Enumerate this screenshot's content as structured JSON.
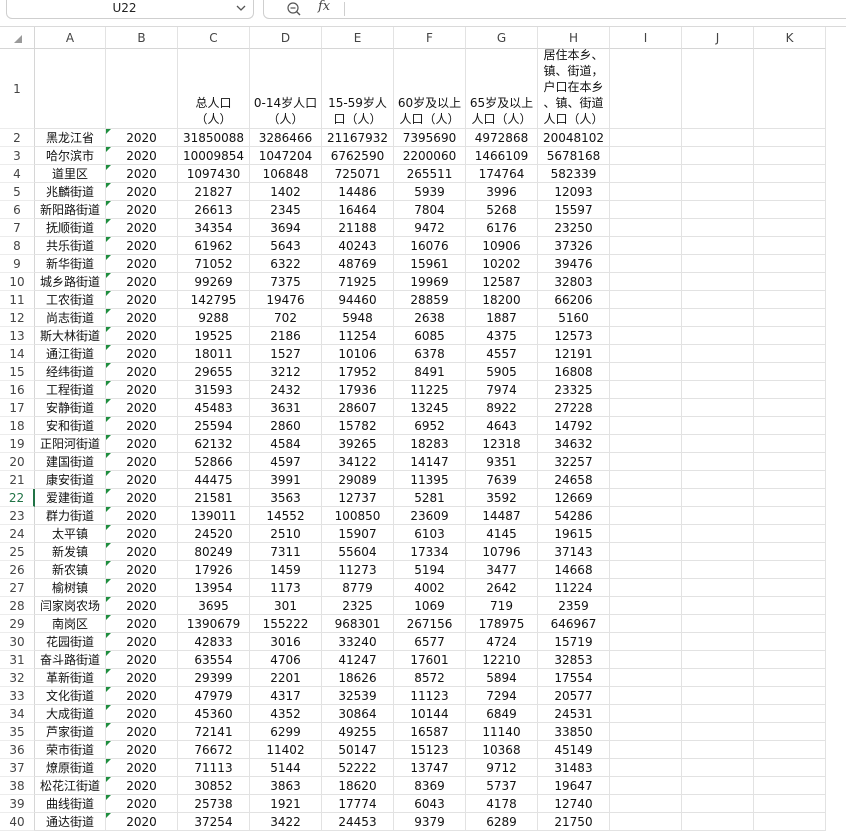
{
  "name_box": "U22",
  "formula_bar": {
    "fx_label": "fx",
    "value": ""
  },
  "columns": [
    "A",
    "B",
    "C",
    "D",
    "E",
    "F",
    "G",
    "H",
    "I",
    "J",
    "K"
  ],
  "active_row": "22",
  "header_row": {
    "row_num": "1",
    "cells": [
      "",
      "",
      "总人口\n（人）",
      "0-14岁人口\n（人）",
      "15-59岁人\n口（人）",
      "60岁及以上\n人口（人）",
      "65岁及以上\n人口（人）",
      "居住本乡、\n镇、街道，\n户口在本乡\n、镇、街道\n人口（人）"
    ]
  },
  "rows": [
    {
      "n": "2",
      "a": "黑龙江省",
      "b": "2020",
      "c": "31850088",
      "d": "3286466",
      "e": "21167932",
      "f": "7395690",
      "g": "4972868",
      "h": "20048102"
    },
    {
      "n": "3",
      "a": "哈尔滨市",
      "b": "2020",
      "c": "10009854",
      "d": "1047204",
      "e": "6762590",
      "f": "2200060",
      "g": "1466109",
      "h": "5678168"
    },
    {
      "n": "4",
      "a": "道里区",
      "b": "2020",
      "c": "1097430",
      "d": "106848",
      "e": "725071",
      "f": "265511",
      "g": "174764",
      "h": "582339"
    },
    {
      "n": "5",
      "a": "兆麟街道",
      "b": "2020",
      "c": "21827",
      "d": "1402",
      "e": "14486",
      "f": "5939",
      "g": "3996",
      "h": "12093"
    },
    {
      "n": "6",
      "a": "新阳路街道",
      "b": "2020",
      "c": "26613",
      "d": "2345",
      "e": "16464",
      "f": "7804",
      "g": "5268",
      "h": "15597"
    },
    {
      "n": "7",
      "a": "抚顺街道",
      "b": "2020",
      "c": "34354",
      "d": "3694",
      "e": "21188",
      "f": "9472",
      "g": "6176",
      "h": "23250"
    },
    {
      "n": "8",
      "a": "共乐街道",
      "b": "2020",
      "c": "61962",
      "d": "5643",
      "e": "40243",
      "f": "16076",
      "g": "10906",
      "h": "37326"
    },
    {
      "n": "9",
      "a": "新华街道",
      "b": "2020",
      "c": "71052",
      "d": "6322",
      "e": "48769",
      "f": "15961",
      "g": "10202",
      "h": "39476"
    },
    {
      "n": "10",
      "a": "城乡路街道",
      "b": "2020",
      "c": "99269",
      "d": "7375",
      "e": "71925",
      "f": "19969",
      "g": "12587",
      "h": "32803"
    },
    {
      "n": "11",
      "a": "工农街道",
      "b": "2020",
      "c": "142795",
      "d": "19476",
      "e": "94460",
      "f": "28859",
      "g": "18200",
      "h": "66206"
    },
    {
      "n": "12",
      "a": "尚志街道",
      "b": "2020",
      "c": "9288",
      "d": "702",
      "e": "5948",
      "f": "2638",
      "g": "1887",
      "h": "5160"
    },
    {
      "n": "13",
      "a": "斯大林街道",
      "b": "2020",
      "c": "19525",
      "d": "2186",
      "e": "11254",
      "f": "6085",
      "g": "4375",
      "h": "12573"
    },
    {
      "n": "14",
      "a": "通江街道",
      "b": "2020",
      "c": "18011",
      "d": "1527",
      "e": "10106",
      "f": "6378",
      "g": "4557",
      "h": "12191"
    },
    {
      "n": "15",
      "a": "经纬街道",
      "b": "2020",
      "c": "29655",
      "d": "3212",
      "e": "17952",
      "f": "8491",
      "g": "5905",
      "h": "16808"
    },
    {
      "n": "16",
      "a": "工程街道",
      "b": "2020",
      "c": "31593",
      "d": "2432",
      "e": "17936",
      "f": "11225",
      "g": "7974",
      "h": "23325"
    },
    {
      "n": "17",
      "a": "安静街道",
      "b": "2020",
      "c": "45483",
      "d": "3631",
      "e": "28607",
      "f": "13245",
      "g": "8922",
      "h": "27228"
    },
    {
      "n": "18",
      "a": "安和街道",
      "b": "2020",
      "c": "25594",
      "d": "2860",
      "e": "15782",
      "f": "6952",
      "g": "4643",
      "h": "14792"
    },
    {
      "n": "19",
      "a": "正阳河街道",
      "b": "2020",
      "c": "62132",
      "d": "4584",
      "e": "39265",
      "f": "18283",
      "g": "12318",
      "h": "34632"
    },
    {
      "n": "20",
      "a": "建国街道",
      "b": "2020",
      "c": "52866",
      "d": "4597",
      "e": "34122",
      "f": "14147",
      "g": "9351",
      "h": "32257"
    },
    {
      "n": "21",
      "a": "康安街道",
      "b": "2020",
      "c": "44475",
      "d": "3991",
      "e": "29089",
      "f": "11395",
      "g": "7639",
      "h": "24658"
    },
    {
      "n": "22",
      "a": "爱建街道",
      "b": "2020",
      "c": "21581",
      "d": "3563",
      "e": "12737",
      "f": "5281",
      "g": "3592",
      "h": "12669"
    },
    {
      "n": "23",
      "a": "群力街道",
      "b": "2020",
      "c": "139011",
      "d": "14552",
      "e": "100850",
      "f": "23609",
      "g": "14487",
      "h": "54286"
    },
    {
      "n": "24",
      "a": "太平镇",
      "b": "2020",
      "c": "24520",
      "d": "2510",
      "e": "15907",
      "f": "6103",
      "g": "4145",
      "h": "19615"
    },
    {
      "n": "25",
      "a": "新发镇",
      "b": "2020",
      "c": "80249",
      "d": "7311",
      "e": "55604",
      "f": "17334",
      "g": "10796",
      "h": "37143"
    },
    {
      "n": "26",
      "a": "新农镇",
      "b": "2020",
      "c": "17926",
      "d": "1459",
      "e": "11273",
      "f": "5194",
      "g": "3477",
      "h": "14668"
    },
    {
      "n": "27",
      "a": "榆树镇",
      "b": "2020",
      "c": "13954",
      "d": "1173",
      "e": "8779",
      "f": "4002",
      "g": "2642",
      "h": "11224"
    },
    {
      "n": "28",
      "a": "闫家岗农场",
      "b": "2020",
      "c": "3695",
      "d": "301",
      "e": "2325",
      "f": "1069",
      "g": "719",
      "h": "2359"
    },
    {
      "n": "29",
      "a": "南岗区",
      "b": "2020",
      "c": "1390679",
      "d": "155222",
      "e": "968301",
      "f": "267156",
      "g": "178975",
      "h": "646967"
    },
    {
      "n": "30",
      "a": "花园街道",
      "b": "2020",
      "c": "42833",
      "d": "3016",
      "e": "33240",
      "f": "6577",
      "g": "4724",
      "h": "15719"
    },
    {
      "n": "31",
      "a": "奋斗路街道",
      "b": "2020",
      "c": "63554",
      "d": "4706",
      "e": "41247",
      "f": "17601",
      "g": "12210",
      "h": "32853"
    },
    {
      "n": "32",
      "a": "革新街道",
      "b": "2020",
      "c": "29399",
      "d": "2201",
      "e": "18626",
      "f": "8572",
      "g": "5894",
      "h": "17554"
    },
    {
      "n": "33",
      "a": "文化街道",
      "b": "2020",
      "c": "47979",
      "d": "4317",
      "e": "32539",
      "f": "11123",
      "g": "7294",
      "h": "20577"
    },
    {
      "n": "34",
      "a": "大成街道",
      "b": "2020",
      "c": "45360",
      "d": "4352",
      "e": "30864",
      "f": "10144",
      "g": "6849",
      "h": "24531"
    },
    {
      "n": "35",
      "a": "芦家街道",
      "b": "2020",
      "c": "72141",
      "d": "6299",
      "e": "49255",
      "f": "16587",
      "g": "11140",
      "h": "33850"
    },
    {
      "n": "36",
      "a": "荣市街道",
      "b": "2020",
      "c": "76672",
      "d": "11402",
      "e": "50147",
      "f": "15123",
      "g": "10368",
      "h": "45149"
    },
    {
      "n": "37",
      "a": "燎原街道",
      "b": "2020",
      "c": "71113",
      "d": "5144",
      "e": "52222",
      "f": "13747",
      "g": "9712",
      "h": "31483"
    },
    {
      "n": "38",
      "a": "松花江街道",
      "b": "2020",
      "c": "30852",
      "d": "3863",
      "e": "18620",
      "f": "8369",
      "g": "5737",
      "h": "19647"
    },
    {
      "n": "39",
      "a": "曲线街道",
      "b": "2020",
      "c": "25738",
      "d": "1921",
      "e": "17774",
      "f": "6043",
      "g": "4178",
      "h": "12740"
    },
    {
      "n": "40",
      "a": "通达街道",
      "b": "2020",
      "c": "37254",
      "d": "3422",
      "e": "24453",
      "f": "9379",
      "g": "6289",
      "h": "21750"
    }
  ]
}
